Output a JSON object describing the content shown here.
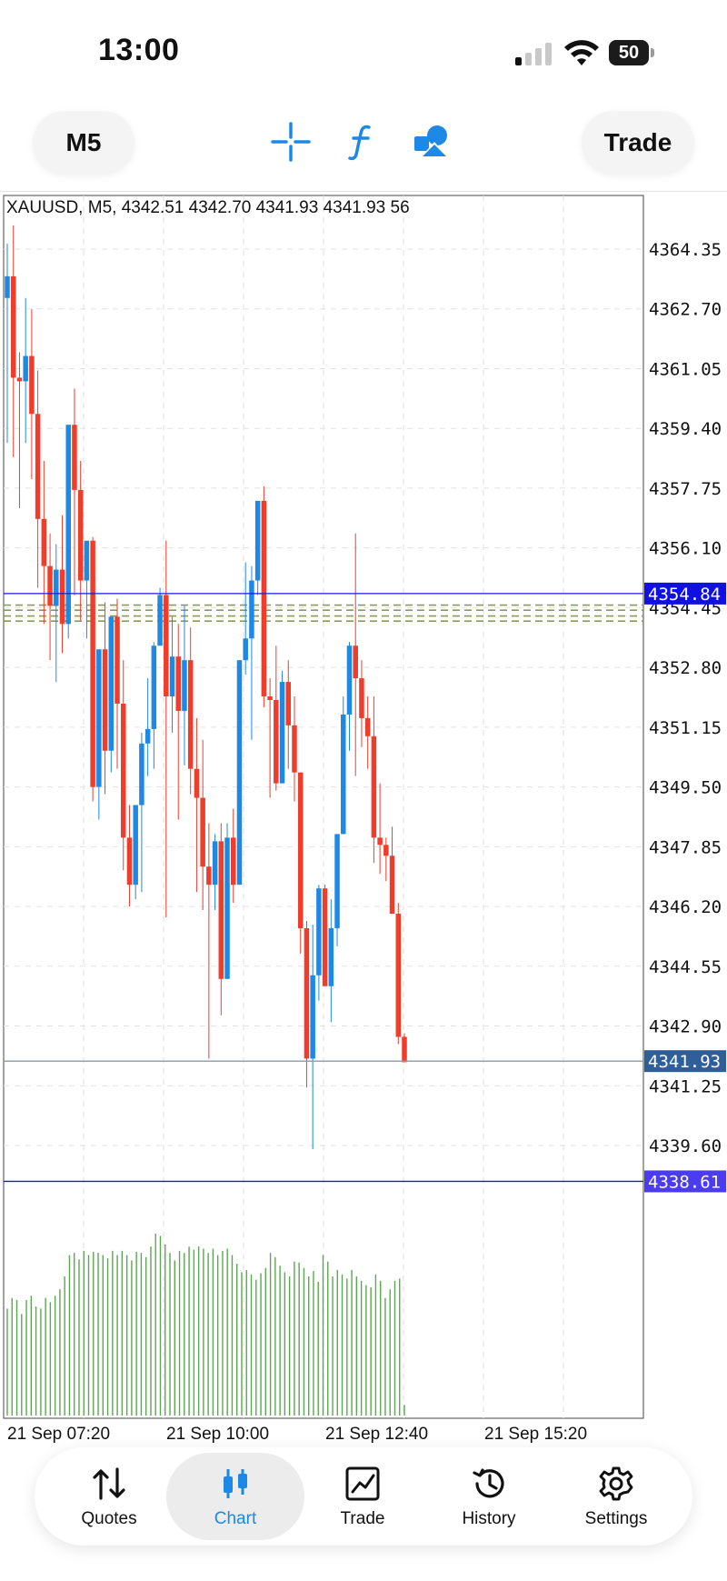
{
  "status_bar": {
    "time": "13:00",
    "battery": "50",
    "signal_bars_on": 1,
    "signal_bars_total": 4
  },
  "toolbar": {
    "timeframe_label": "M5",
    "trade_label": "Trade",
    "icons": [
      "crosshair-icon",
      "function-icon",
      "objects-icon"
    ]
  },
  "colors": {
    "bull": "#1e88e5",
    "bear": "#f03c2a",
    "volume": "#5aa84f",
    "accent": "#1e88e5",
    "bid_line": "#1a1ad6",
    "last_label_bg": "#2f5f9a",
    "low_label_bg": "#4b3cf0"
  },
  "chart_data": {
    "type": "candlestick",
    "symbol_info": "XAUUSD, M5, 4342.51 4342.70 4341.93 4341.93 56",
    "price_ticks": [
      "4364.35",
      "4362.70",
      "4361.05",
      "4359.40",
      "4357.75",
      "4356.10",
      "4354.45",
      "4352.80",
      "4351.15",
      "4349.50",
      "4347.85",
      "4346.20",
      "4344.55",
      "4342.90",
      "4341.25",
      "4339.60"
    ],
    "time_labels": [
      "21 Sep 07:20",
      "21 Sep 10:00",
      "21 Sep 12:40",
      "21 Sep 15:20"
    ],
    "ylim": [
      4338.0,
      4365.5
    ],
    "bid_line": {
      "price": 4354.84,
      "label": "4354.84"
    },
    "last_line": {
      "price": 4341.93,
      "label": "4341.93"
    },
    "low_line": {
      "price": 4338.61,
      "label": "4338.61"
    },
    "order_levels": [
      4354.52,
      4354.38,
      4354.22,
      4354.08
    ],
    "candles": [
      [
        4363.0,
        4364.5,
        4363.6,
        4359.0
      ],
      [
        4363.6,
        4365.0,
        4360.8,
        4358.6
      ],
      [
        4360.8,
        4361.5,
        4360.7,
        4357.2
      ],
      [
        4360.7,
        4363.0,
        4361.4,
        4359.0
      ],
      [
        4361.4,
        4362.7,
        4359.8,
        4358.0
      ],
      [
        4359.8,
        4361.0,
        4356.9,
        4355.0
      ],
      [
        4356.9,
        4358.5,
        4355.6,
        4354.0
      ],
      [
        4355.6,
        4356.5,
        4354.5,
        4353.0
      ],
      [
        4354.5,
        4356.2,
        4355.5,
        4352.4
      ],
      [
        4355.5,
        4357.0,
        4354.0,
        4353.2
      ],
      [
        4354.0,
        4359.0,
        4359.5,
        4353.6
      ],
      [
        4359.5,
        4360.5,
        4357.7,
        4354.8
      ],
      [
        4357.7,
        4358.5,
        4355.2,
        4354.1
      ],
      [
        4355.2,
        4356.0,
        4356.3,
        4353.6
      ],
      [
        4356.3,
        4356.4,
        4349.5,
        4349.1
      ],
      [
        4349.5,
        4351.0,
        4353.3,
        4348.6
      ],
      [
        4353.3,
        4354.6,
        4350.5,
        4349.3
      ],
      [
        4350.5,
        4352.6,
        4354.2,
        4349.9
      ],
      [
        4354.2,
        4354.7,
        4351.8,
        4350.0
      ],
      [
        4351.8,
        4353.0,
        4348.1,
        4347.2
      ],
      [
        4348.1,
        4349.0,
        4346.8,
        4346.2
      ],
      [
        4346.8,
        4349.0,
        4349.0,
        4346.4
      ],
      [
        4349.0,
        4351.0,
        4350.7,
        4346.6
      ],
      [
        4350.7,
        4352.5,
        4351.1,
        4349.8
      ],
      [
        4351.1,
        4353.5,
        4353.4,
        4350.0
      ],
      [
        4353.4,
        4355.0,
        4354.8,
        4353.6
      ],
      [
        4354.8,
        4356.3,
        4352.0,
        4345.9
      ],
      [
        4352.0,
        4354.2,
        4353.1,
        4351.0
      ],
      [
        4353.1,
        4354.0,
        4351.6,
        4348.6
      ],
      [
        4351.6,
        4354.5,
        4353.0,
        4350.1
      ],
      [
        4353.0,
        4353.9,
        4350.0,
        4349.3
      ],
      [
        4350.0,
        4351.4,
        4349.2,
        4346.6
      ],
      [
        4349.2,
        4350.8,
        4347.3,
        4346.1
      ],
      [
        4347.3,
        4348.5,
        4346.8,
        4342.0
      ],
      [
        4346.8,
        4348.2,
        4348.0,
        4346.1
      ],
      [
        4348.0,
        4348.5,
        4344.2,
        4343.2
      ],
      [
        4344.2,
        4348.5,
        4348.1,
        4344.2
      ],
      [
        4348.1,
        4348.9,
        4346.8,
        4346.3
      ],
      [
        4346.8,
        4353.0,
        4353.0,
        4346.8
      ],
      [
        4353.0,
        4355.7,
        4353.6,
        4352.6
      ],
      [
        4353.6,
        4355.6,
        4355.2,
        4350.8
      ],
      [
        4355.2,
        4357.2,
        4357.4,
        4354.8
      ],
      [
        4357.4,
        4357.8,
        4352.0,
        4351.7
      ],
      [
        4352.0,
        4352.5,
        4351.9,
        4349.2
      ],
      [
        4351.9,
        4353.4,
        4349.6,
        4349.4
      ],
      [
        4349.6,
        4352.7,
        4352.4,
        4349.6
      ],
      [
        4352.4,
        4353.0,
        4351.2,
        4350.0
      ],
      [
        4351.2,
        4352.0,
        4349.9,
        4349.1
      ],
      [
        4349.9,
        4349.9,
        4345.6,
        4344.9
      ],
      [
        4345.6,
        4345.8,
        4342.0,
        4341.2
      ],
      [
        4342.0,
        4345.7,
        4344.3,
        4339.5
      ],
      [
        4344.3,
        4346.8,
        4346.7,
        4343.6
      ],
      [
        4346.7,
        4346.8,
        4344.0,
        4344.0
      ],
      [
        4344.0,
        4346.4,
        4345.6,
        4343.0
      ],
      [
        4345.6,
        4346.8,
        4348.2,
        4345.1
      ],
      [
        4348.2,
        4352.0,
        4351.5,
        4348.2
      ],
      [
        4351.5,
        4353.5,
        4353.4,
        4350.5
      ],
      [
        4353.4,
        4356.5,
        4352.5,
        4349.8
      ],
      [
        4352.5,
        4353.0,
        4351.4,
        4350.6
      ],
      [
        4351.4,
        4352.0,
        4350.9,
        4350.0
      ],
      [
        4350.9,
        4352.0,
        4348.1,
        4347.4
      ],
      [
        4348.1,
        4349.6,
        4347.9,
        4347.1
      ],
      [
        4347.9,
        4348.1,
        4347.6,
        4346.9
      ],
      [
        4347.6,
        4348.4,
        4346.0,
        4346.0
      ],
      [
        4346.0,
        4346.3,
        4342.6,
        4342.4
      ],
      [
        4342.6,
        4342.7,
        4341.9,
        4341.9
      ]
    ],
    "volumes": [
      100,
      110,
      108,
      95,
      108,
      112,
      102,
      100,
      110,
      106,
      112,
      118,
      130,
      150,
      152,
      146,
      154,
      150,
      153,
      152,
      150,
      147,
      154,
      150,
      154,
      150,
      145,
      153,
      152,
      148,
      158,
      170,
      168,
      160,
      152,
      145,
      154,
      152,
      158,
      155,
      158,
      156,
      152,
      156,
      150,
      154,
      156,
      150,
      142,
      134,
      136,
      132,
      127,
      133,
      138,
      152,
      148,
      140,
      134,
      130,
      144,
      143,
      138,
      130,
      135,
      125,
      150,
      144,
      130,
      136,
      132,
      128,
      136,
      130,
      126,
      122,
      120,
      132,
      126,
      110,
      118,
      126,
      128,
      10
    ]
  },
  "bottom_nav": {
    "items": [
      {
        "label": "Quotes",
        "icon": "quotes-icon",
        "active": false
      },
      {
        "label": "Chart",
        "icon": "chart-icon",
        "active": true
      },
      {
        "label": "Trade",
        "icon": "trade-icon",
        "active": false
      },
      {
        "label": "History",
        "icon": "history-icon",
        "active": false
      },
      {
        "label": "Settings",
        "icon": "settings-icon",
        "active": false
      }
    ]
  }
}
